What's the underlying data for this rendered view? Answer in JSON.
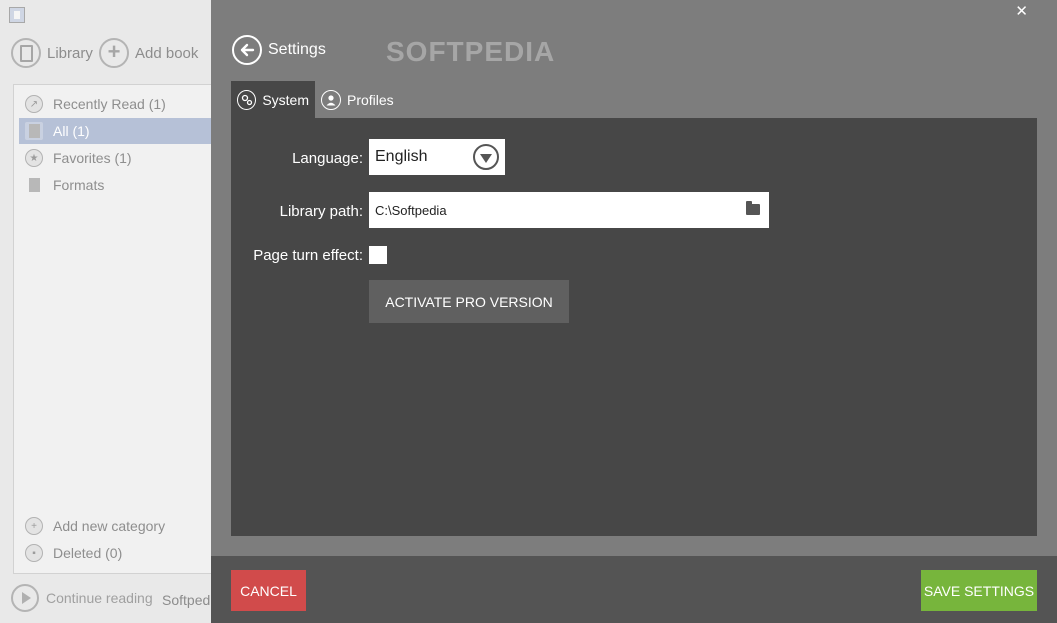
{
  "library": {
    "library_label": "Library",
    "add_book_label": "Add book",
    "nav_items": [
      {
        "label": "Recently Read (1)",
        "icon": "share-icon"
      },
      {
        "label": "All (1)",
        "icon": "book-icon",
        "selected": true
      },
      {
        "label": "Favorites (1)",
        "icon": "star-icon"
      },
      {
        "label": "Formats",
        "icon": "file-icon"
      }
    ],
    "add_category_label": "Add new category",
    "deleted_label": "Deleted (0)",
    "continue_reading_label": "Continue reading",
    "continue_book": "Softpedia"
  },
  "settings": {
    "title": "Settings",
    "watermark": "SOFTPEDIA",
    "close_glyph": "✕",
    "tabs": [
      {
        "label": "System",
        "icon": "gears-icon",
        "active": true
      },
      {
        "label": "Profiles",
        "icon": "user-icon",
        "active": false
      }
    ],
    "language_label": "Language:",
    "language_value": "English",
    "library_path_label": "Library path:",
    "library_path_value": "C:\\Softpedia",
    "page_turn_label": "Page turn effect:",
    "page_turn_checked": false,
    "activate_pro_label": "ACTIVATE PRO VERSION",
    "cancel_label": "CANCEL",
    "save_label": "SAVE SETTINGS"
  },
  "colors": {
    "overlay_bg": "#7d7d7d",
    "panel_bg": "#474747",
    "cancel": "#d14b4b",
    "save": "#77b53c",
    "selected_nav": "#b6c1d7"
  }
}
